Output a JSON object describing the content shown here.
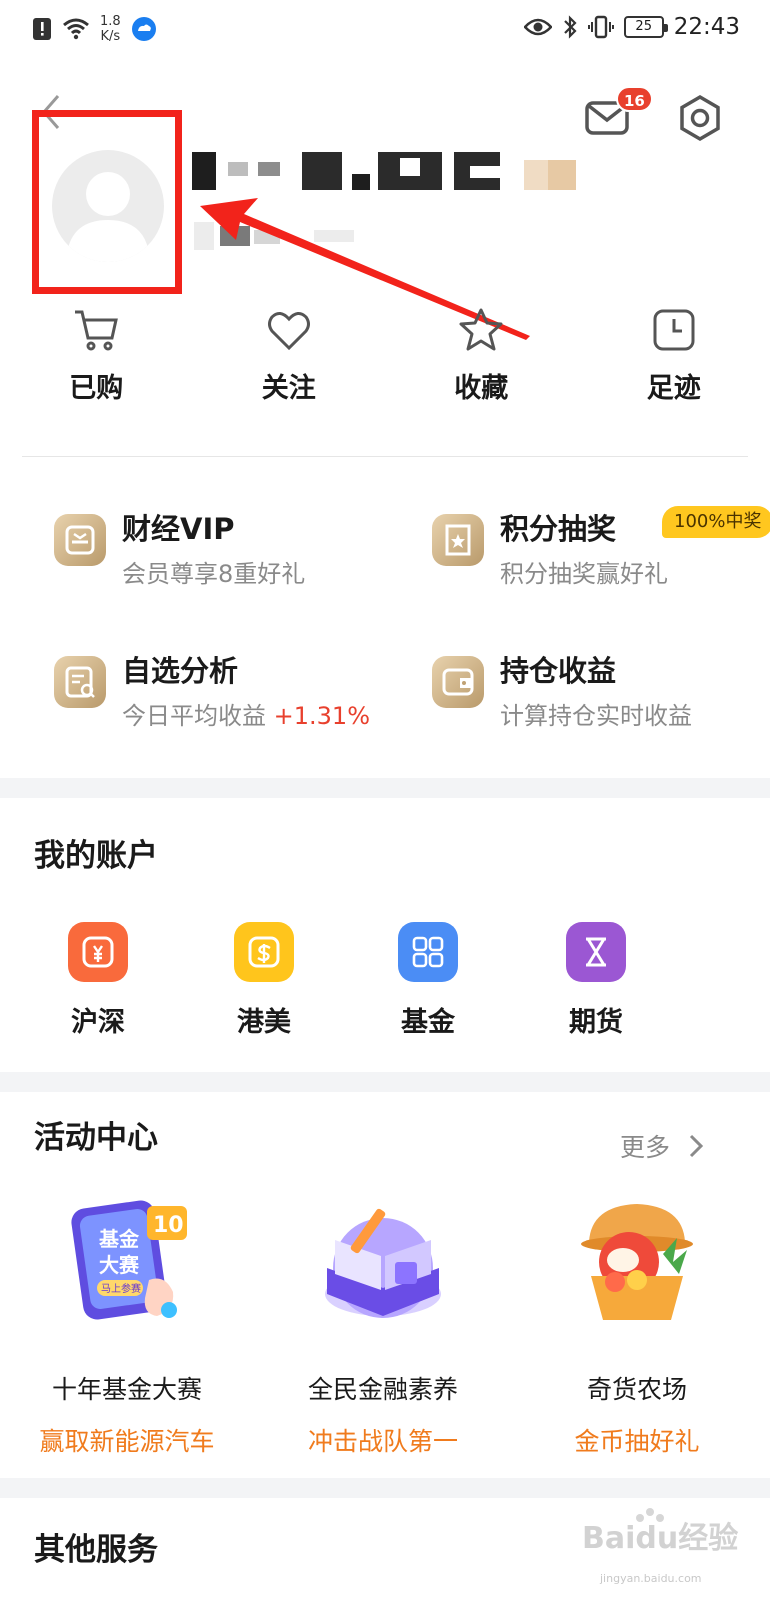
{
  "status_bar": {
    "speed_value": "1.8",
    "speed_unit": "K/s",
    "battery": "25",
    "time": "22:43"
  },
  "header": {
    "mail_badge": "16"
  },
  "quick_actions": [
    {
      "label": "已购",
      "icon": "cart-icon"
    },
    {
      "label": "关注",
      "icon": "heart-icon"
    },
    {
      "label": "收藏",
      "icon": "star-icon"
    },
    {
      "label": "足迹",
      "icon": "clock-icon"
    }
  ],
  "services": [
    {
      "title": "财经VIP",
      "subtitle": "会员尊享8重好礼"
    },
    {
      "title": "积分抽奖",
      "subtitle": "积分抽奖赢好礼",
      "badge": "100%中奖"
    },
    {
      "title": "自选分析",
      "subtitle_prefix": "今日平均收益 ",
      "subtitle_value": "+1.31%"
    },
    {
      "title": "持仓收益",
      "subtitle": "计算持仓实时收益"
    }
  ],
  "accounts": {
    "title": "我的账户",
    "items": [
      {
        "label": "沪深",
        "color": "#f96a3c"
      },
      {
        "label": "港美",
        "color": "#ffc51c"
      },
      {
        "label": "基金",
        "color": "#4b8df5"
      },
      {
        "label": "期货",
        "color": "#9b57d3"
      }
    ]
  },
  "activities": {
    "title": "活动中心",
    "more": "更多",
    "items": [
      {
        "title": "十年基金大赛",
        "subtitle": "赢取新能源汽车",
        "art_text_1": "基金",
        "art_text_2": "大赛",
        "art_text_3": "马上参赛",
        "art_badge": "10"
      },
      {
        "title": "全民金融素养",
        "subtitle": "冲击战队第一"
      },
      {
        "title": "奇货农场",
        "subtitle": "金币抽好礼"
      }
    ]
  },
  "other_services": {
    "title": "其他服务"
  },
  "watermark": {
    "text": "Baidu经验",
    "url": "jingyan.baidu.com"
  }
}
